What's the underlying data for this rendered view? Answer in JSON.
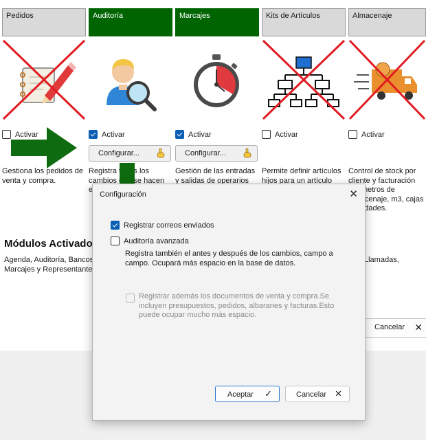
{
  "modules": [
    {
      "header": "Pedidos",
      "active": false,
      "icon": "notebook-pencil-icon",
      "crossed": true,
      "checkbox_label": "Activar",
      "checked": false,
      "configure_label": "",
      "description": "Gestiona los pedidos de venta y compra."
    },
    {
      "header": "Auditoría",
      "active": true,
      "icon": "user-search-icon",
      "crossed": false,
      "checkbox_label": "Activar",
      "checked": true,
      "configure_label": "Configurar...",
      "description": "Registra todos los cambios que se hacen en los"
    },
    {
      "header": "Marcajes",
      "active": true,
      "icon": "stopwatch-icon",
      "crossed": false,
      "checkbox_label": "Activar",
      "checked": true,
      "configure_label": "Configurar...",
      "description": "Gestión de las entradas y salidas de operarios"
    },
    {
      "header": "Kits de Artículos",
      "active": false,
      "icon": "hierarchy-icon",
      "crossed": true,
      "checkbox_label": "Activar",
      "checked": false,
      "configure_label": "",
      "description": "Permite definir artículos hijos para un artículo"
    },
    {
      "header": "Almacenaje",
      "active": false,
      "icon": "delivery-truck-icon",
      "crossed": true,
      "checkbox_label": "Activar",
      "checked": false,
      "configure_label": "",
      "description": "Control de stock por cliente y facturación por metros de almacenaje, m3, cajas y unidades."
    }
  ],
  "active_modules": {
    "title": "Módulos Activados",
    "text": "Agenda, Auditoría, Bancos, Marcajes y Representantes",
    "text_right": "Llamadas,"
  },
  "background_cancel_label": "Cancelar",
  "dialog": {
    "title": "Configuración",
    "option1_label": "Registrar correos enviados",
    "option1_checked": true,
    "option2_label": "Auditoría avanzada",
    "option2_checked": false,
    "option2_note": "Registra también el antes y después de los cambios, campo a campo. Ocupará más espacio en la base de datos.",
    "option3_label": "Registrar además los documentos de venta y compra.Se incluyen presupuestos, pedidos, albaranes y facturas.Esto puede ocupar mucho más espacio.",
    "option3_checked": false,
    "accept_label": "Aceptar",
    "cancel_label": "Cancelar"
  },
  "colors": {
    "active_header": "#006400",
    "arrow": "#0f6b0f",
    "cross": "#e11b22",
    "checkbox": "#0a5fb4"
  }
}
